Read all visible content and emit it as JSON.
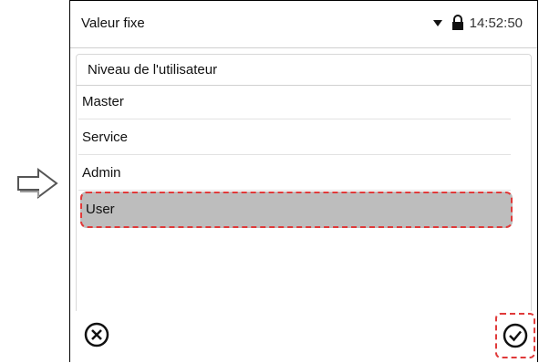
{
  "status_bar": {
    "title": "Valeur fixe",
    "time": "14:52:50",
    "signal_icon": "signal-down-icon",
    "lock_icon": "lock-icon"
  },
  "panel": {
    "title": "Niveau de l'utilisateur",
    "items": [
      {
        "label": "Master",
        "selected": false
      },
      {
        "label": "Service",
        "selected": false
      },
      {
        "label": "Admin",
        "selected": false
      },
      {
        "label": "User",
        "selected": true
      }
    ]
  },
  "footer": {
    "cancel_icon": "close-circle-icon",
    "confirm_icon": "check-circle-icon"
  },
  "colors": {
    "selected_bg": "#bdbdbd",
    "highlight": "#e03a3a"
  }
}
